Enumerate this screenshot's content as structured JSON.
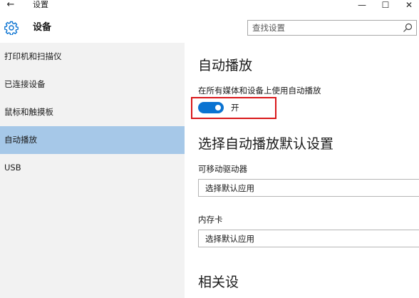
{
  "window": {
    "back_glyph": "←",
    "title": "设置",
    "min_glyph": "—",
    "max_glyph": "☐",
    "close_glyph": "✕"
  },
  "header": {
    "title": "设备",
    "icon": "gear-icon",
    "search": {
      "placeholder": "查找设置",
      "icon": "search-icon"
    }
  },
  "sidebar": {
    "items": [
      {
        "label": "打印机和扫描仪",
        "active": false
      },
      {
        "label": "已连接设备",
        "active": false
      },
      {
        "label": "鼠标和触摸板",
        "active": false
      },
      {
        "label": "自动播放",
        "active": true
      },
      {
        "label": "USB",
        "active": false
      }
    ]
  },
  "main": {
    "section_title": "自动播放",
    "toggle": {
      "label": "在所有媒体和设备上使用自动播放",
      "state_text": "开",
      "on": true
    },
    "defaults_title": "选择自动播放默认设置",
    "removable": {
      "label": "可移动驱动器",
      "value": "选择默认应用"
    },
    "memory_card": {
      "label": "内存卡",
      "value": "选择默认应用"
    },
    "related_title": "相关设"
  },
  "colors": {
    "accent": "#0b73d1",
    "sidebar_bg": "#f2f2f2",
    "sidebar_active": "#a6c8e8",
    "highlight_frame": "#d9171a"
  }
}
